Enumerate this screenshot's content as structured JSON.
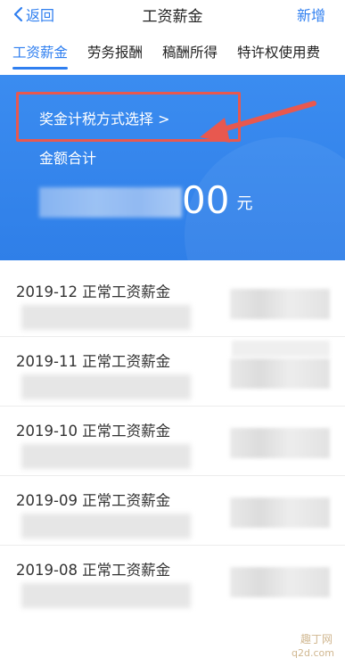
{
  "navbar": {
    "back_label": "返回",
    "title": "工资薪金",
    "add_label": "新增"
  },
  "tabs": [
    {
      "label": "工资薪金",
      "active": true
    },
    {
      "label": "劳务报酬",
      "active": false
    },
    {
      "label": "稿酬所得",
      "active": false
    },
    {
      "label": "特许权使用费",
      "active": false
    }
  ],
  "banner": {
    "bonus_link": "奖金计税方式选择 >",
    "total_label": "金额合计",
    "amount_visible": "00",
    "amount_unit": "元"
  },
  "records": [
    {
      "title": "2019-12 正常工资薪金"
    },
    {
      "title": "2019-11 正常工资薪金"
    },
    {
      "title": "2019-10 正常工资薪金"
    },
    {
      "title": "2019-09 正常工资薪金"
    },
    {
      "title": "2019-08 正常工资薪金"
    }
  ],
  "watermark": {
    "text": "趣丁网",
    "url": "q2d.com"
  },
  "colors": {
    "accent": "#2f7ff0",
    "banner": "#3b8cf0",
    "annotation": "#e8584f"
  }
}
